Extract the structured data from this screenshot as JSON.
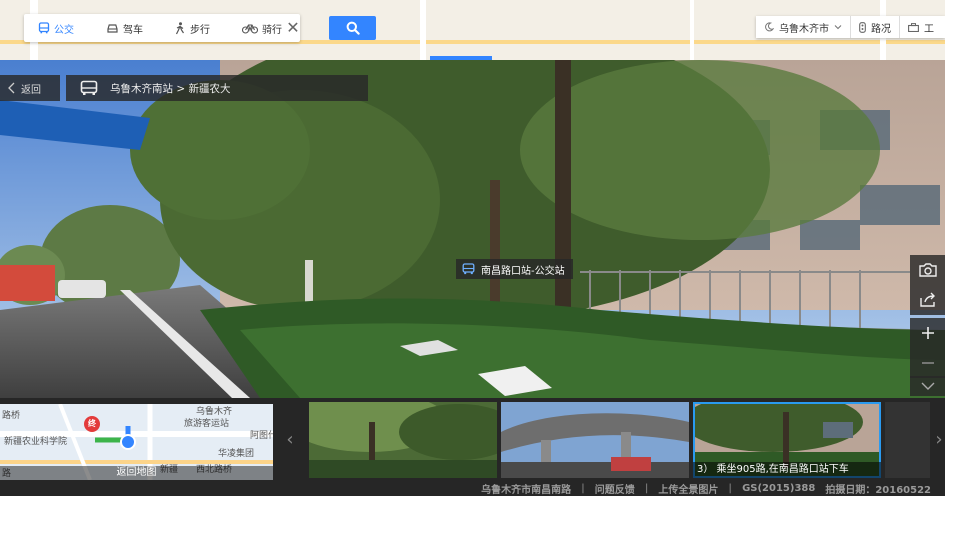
{
  "header": {
    "modes": [
      {
        "label": "公交",
        "icon": "bus-icon",
        "active": true
      },
      {
        "label": "驾车",
        "icon": "car-icon",
        "active": false
      },
      {
        "label": "步行",
        "icon": "walk-icon",
        "active": false
      },
      {
        "label": "骑行",
        "icon": "bike-icon",
        "active": false
      }
    ],
    "close_label": "✕",
    "city": "乌鲁木齐市",
    "traffic": "路况",
    "tools": "工"
  },
  "panorama": {
    "back_label": "返回",
    "route": "乌鲁木齐南站 > 新疆农大",
    "poi_label": "南昌路口站-公交站"
  },
  "minimap": {
    "labels": [
      "乌鲁木齐",
      "旅游客运站",
      "新疆农业科学院",
      "华凌集团",
      "新疆",
      "西北路桥",
      "路桥",
      "阿图什",
      "路"
    ],
    "marker": "终",
    "back_label": "返回地图"
  },
  "thumbnails": [
    {
      "caption": ""
    },
    {
      "caption": ""
    },
    {
      "caption": "3）  乘坐905路,在南昌路口站下车",
      "active": true
    }
  ],
  "footer": {
    "address": "乌鲁木齐市南昌南路",
    "feedback": "问题反馈",
    "upload": "上传全景图片",
    "license": "GS(2015)388",
    "date": "拍摄日期：20160522"
  },
  "colors": {
    "accent": "#3385ff",
    "active_outline": "#2a9af0"
  }
}
